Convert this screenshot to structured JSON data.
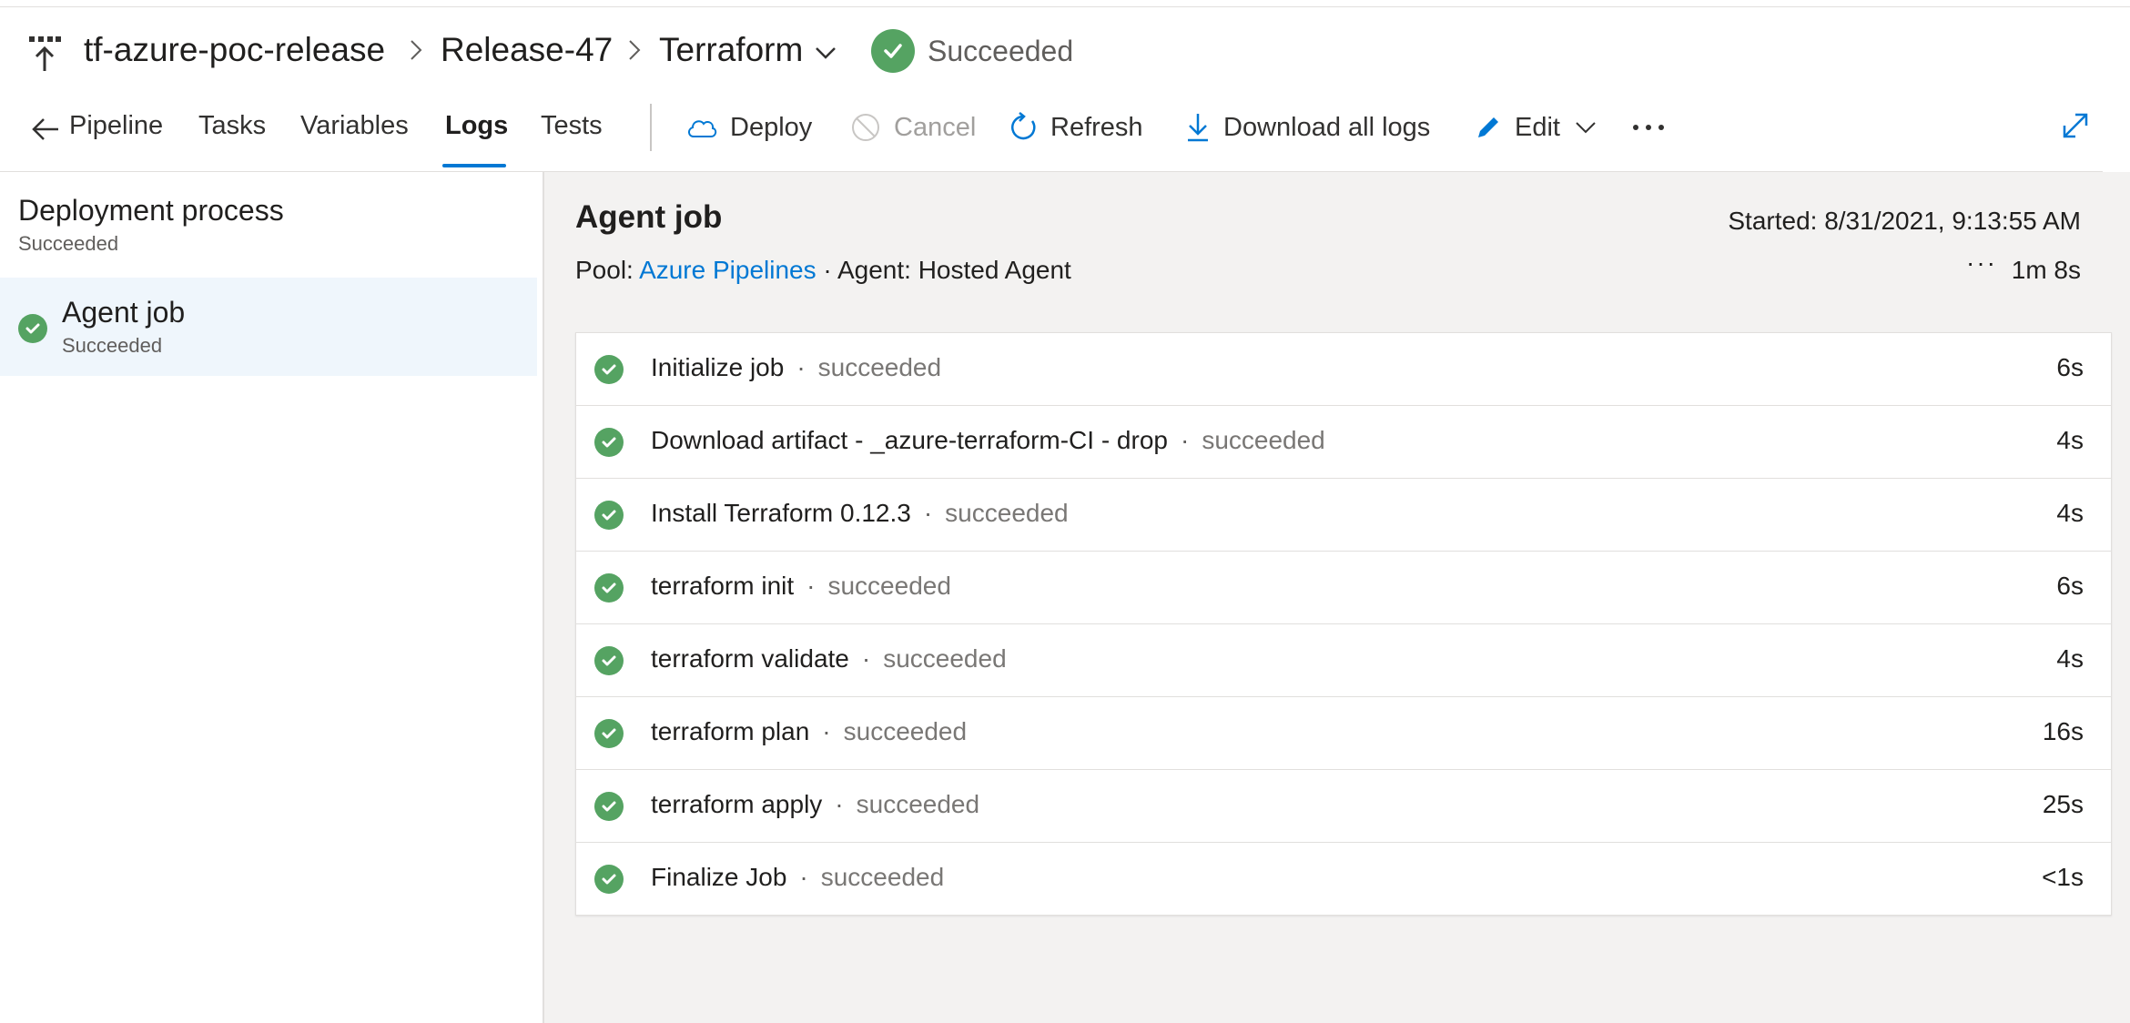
{
  "header": {
    "crumbs": [
      "tf-azure-poc-release",
      "Release-47",
      "Terraform"
    ],
    "status": "Succeeded"
  },
  "toolbar": {
    "tabs": [
      "Pipeline",
      "Tasks",
      "Variables",
      "Logs",
      "Tests"
    ],
    "active_tab": "Logs",
    "deploy": "Deploy",
    "cancel": "Cancel",
    "refresh": "Refresh",
    "download": "Download all logs",
    "edit": "Edit"
  },
  "left": {
    "process_title": "Deployment process",
    "process_status": "Succeeded",
    "job_name": "Agent job",
    "job_status": "Succeeded"
  },
  "right": {
    "title": "Agent job",
    "started": "Started: 8/31/2021, 9:13:55 AM",
    "pool_label": "Pool:",
    "pool_link": "Azure Pipelines",
    "agent": "Agent: Hosted Agent",
    "duration": "1m 8s",
    "steps": [
      {
        "name": "Initialize job",
        "status": "succeeded",
        "duration": "6s"
      },
      {
        "name": "Download artifact - _azure-terraform-CI - drop",
        "status": "succeeded",
        "duration": "4s"
      },
      {
        "name": "Install Terraform 0.12.3",
        "status": "succeeded",
        "duration": "4s"
      },
      {
        "name": "terraform init",
        "status": "succeeded",
        "duration": "6s"
      },
      {
        "name": "terraform validate",
        "status": "succeeded",
        "duration": "4s"
      },
      {
        "name": "terraform plan",
        "status": "succeeded",
        "duration": "16s"
      },
      {
        "name": "terraform apply",
        "status": "succeeded",
        "duration": "25s"
      },
      {
        "name": "Finalize Job",
        "status": "succeeded",
        "duration": "<1s"
      }
    ]
  },
  "colors": {
    "success": "#55a362",
    "accent": "#0078d4"
  }
}
